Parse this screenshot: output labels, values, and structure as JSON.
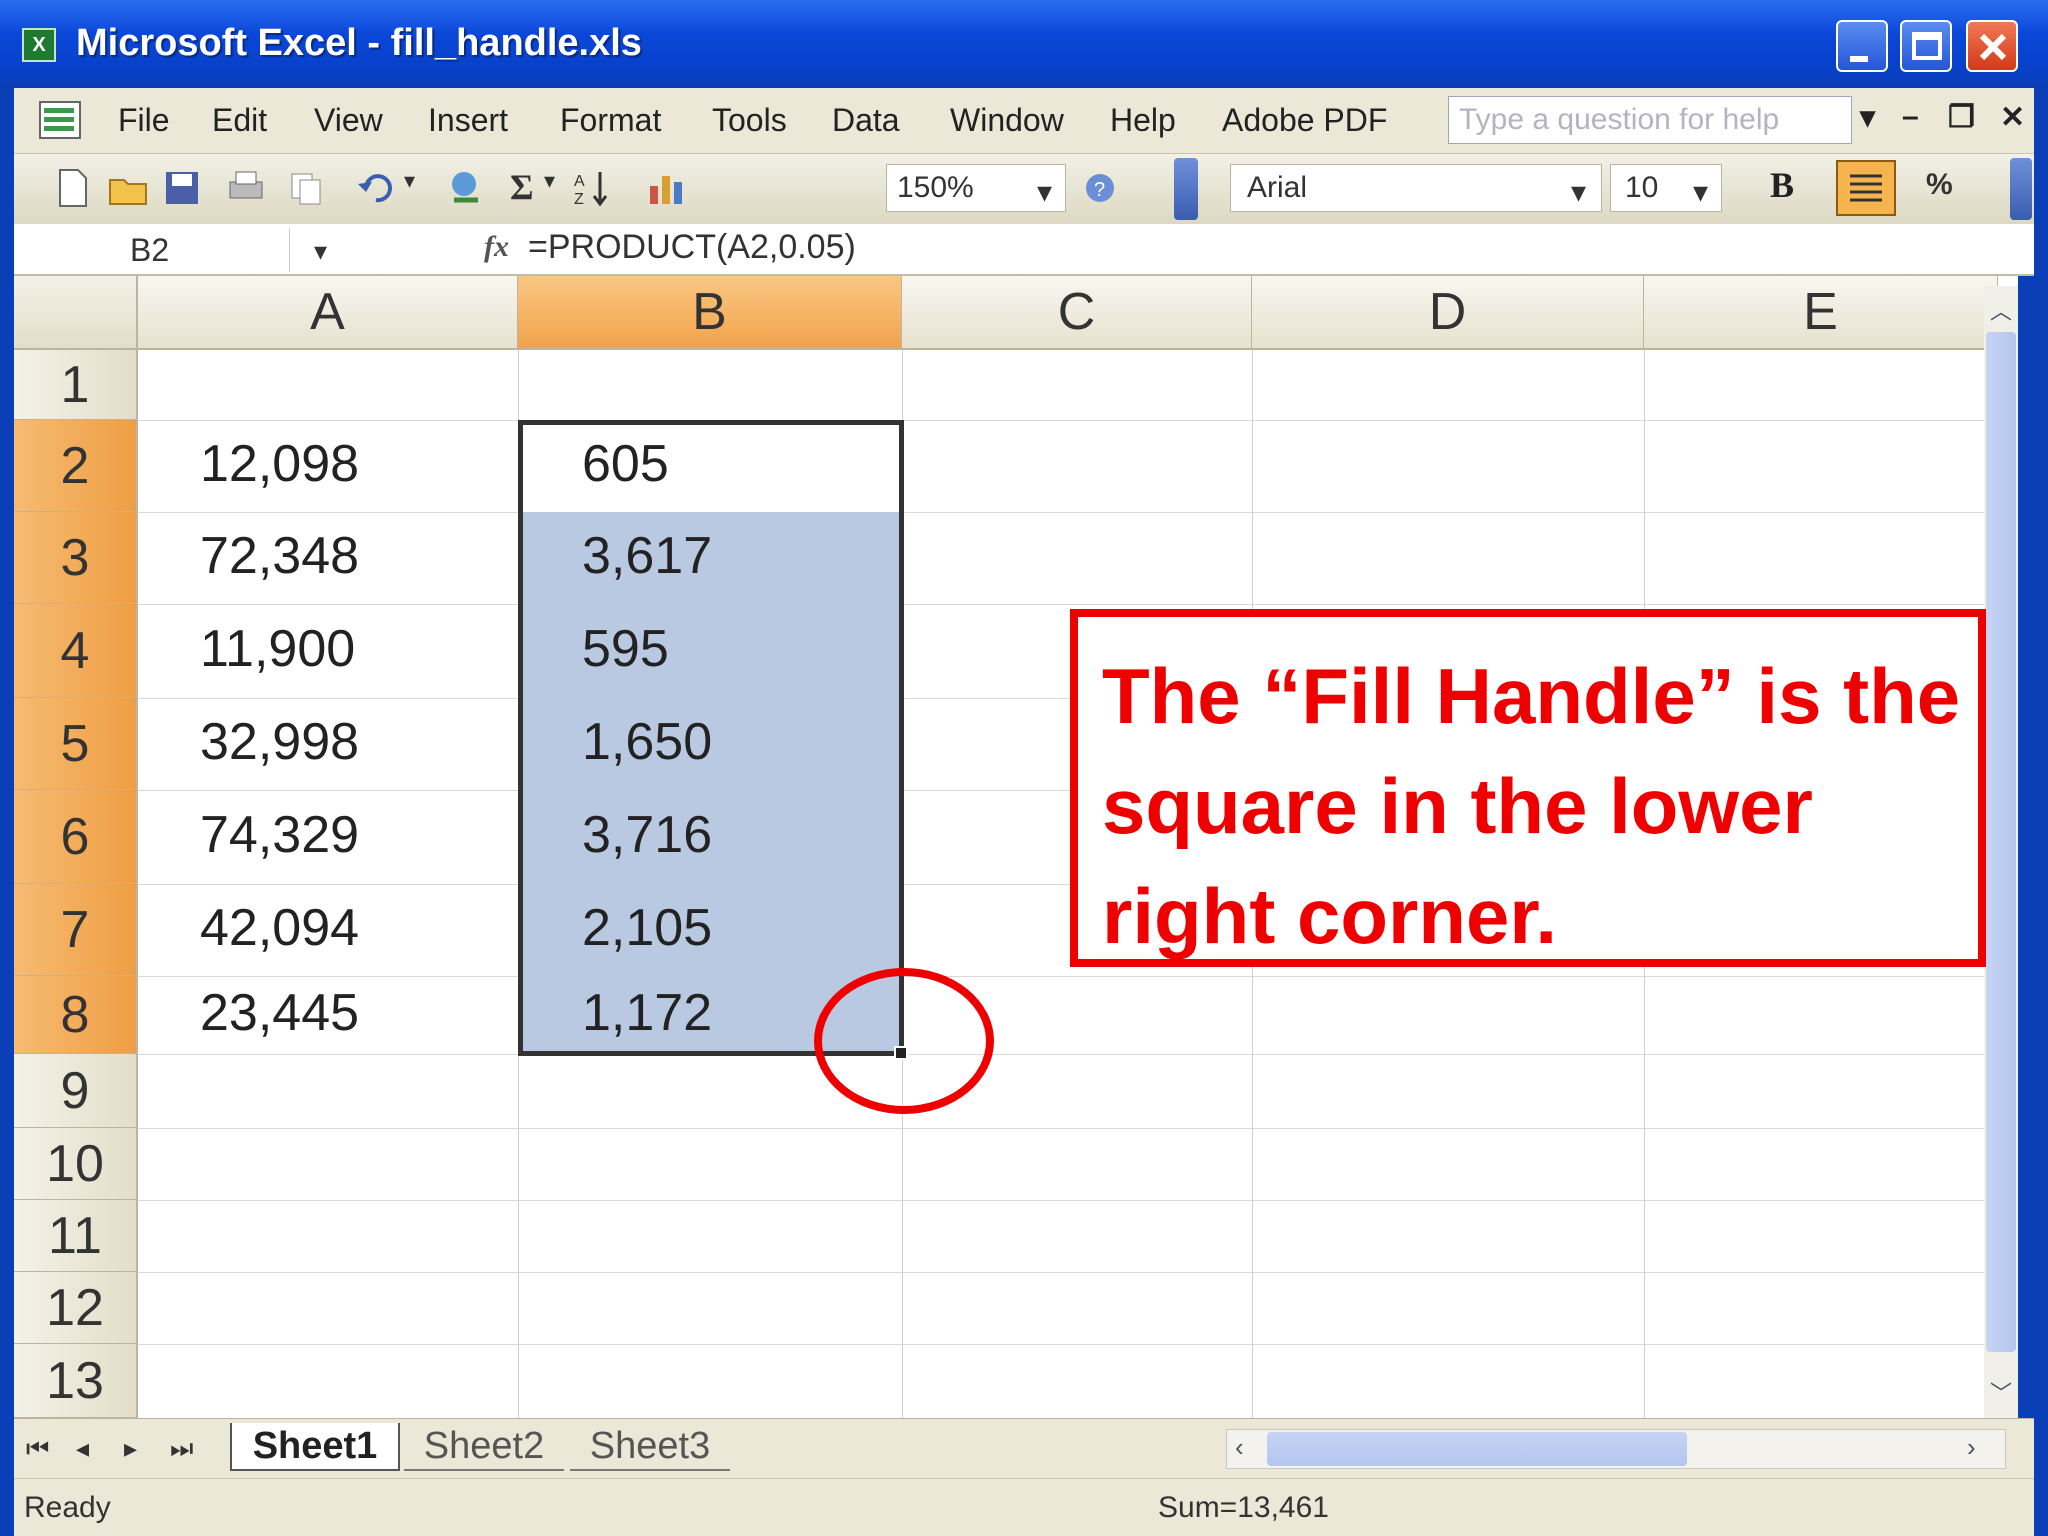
{
  "window": {
    "title": "Microsoft Excel - fill_handle.xls",
    "app_icon": "excel-icon"
  },
  "menubar": {
    "items": [
      "File",
      "Edit",
      "View",
      "Insert",
      "Format",
      "Tools",
      "Data",
      "Window",
      "Help",
      "Adobe PDF"
    ],
    "help_placeholder": "Type a question for help"
  },
  "toolbar": {
    "zoom": "150%",
    "font": "Arial",
    "font_size": "10",
    "bold_label": "B",
    "percent_label": "%",
    "sum_label": "Σ"
  },
  "formula_bar": {
    "name_box": "B2",
    "fx_label": "fx",
    "formula": "=PRODUCT(A2,0.05)"
  },
  "grid": {
    "columns": [
      "A",
      "B",
      "C",
      "D",
      "E"
    ],
    "rows": [
      "1",
      "2",
      "3",
      "4",
      "5",
      "6",
      "7",
      "8",
      "9",
      "10",
      "11",
      "12",
      "13"
    ],
    "column_a": [
      "",
      "12,098",
      "72,348",
      "11,900",
      "32,998",
      "74,329",
      "42,094",
      "23,445"
    ],
    "column_b": [
      "",
      "605",
      "3,617",
      "595",
      "1,650",
      "3,716",
      "2,105",
      "1,172"
    ],
    "selected_range": "B2:B8"
  },
  "annotation": {
    "text": "The “Fill Handle” is the square in the lower right corner.",
    "color": "#ee0000"
  },
  "sheets": {
    "tabs": [
      "Sheet1",
      "Sheet2",
      "Sheet3"
    ],
    "active": "Sheet1"
  },
  "status": {
    "left": "Ready",
    "sum": "Sum=13,461"
  },
  "colors": {
    "selection_fill": "#b9c9e2",
    "header_highlight": "#f1a34b",
    "titlebar": "#0a46d8"
  }
}
